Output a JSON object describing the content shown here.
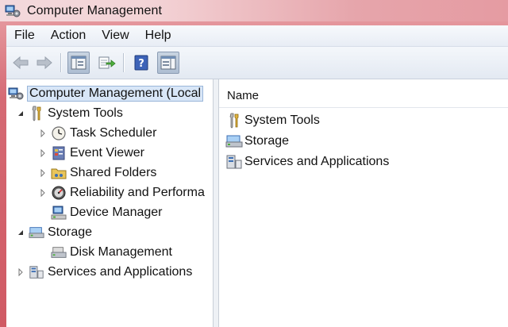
{
  "window": {
    "title": "Computer Management"
  },
  "menubar": {
    "items": [
      "File",
      "Action",
      "View",
      "Help"
    ]
  },
  "toolbar": {
    "buttons": [
      {
        "icon": "back-arrow-icon"
      },
      {
        "icon": "forward-arrow-icon"
      },
      {
        "icon": "show-hide-console-tree-icon",
        "pressed": true
      },
      {
        "icon": "export-list-icon"
      },
      {
        "icon": "help-icon"
      },
      {
        "icon": "show-hide-action-pane-icon",
        "pressed": true
      }
    ]
  },
  "tree": {
    "items": [
      {
        "label": "Computer Management (Local",
        "icon": "computer-management-icon",
        "level": 0,
        "expander": "none",
        "selected": true
      },
      {
        "label": "System Tools",
        "icon": "tools-icon",
        "level": 1,
        "expander": "expanded"
      },
      {
        "label": "Task Scheduler",
        "icon": "clock-icon",
        "level": 2,
        "expander": "collapsed"
      },
      {
        "label": "Event Viewer",
        "icon": "event-viewer-icon",
        "level": 2,
        "expander": "collapsed"
      },
      {
        "label": "Shared Folders",
        "icon": "shared-folders-icon",
        "level": 2,
        "expander": "collapsed"
      },
      {
        "label": "Reliability and Performa",
        "icon": "performance-icon",
        "level": 2,
        "expander": "collapsed"
      },
      {
        "label": "Device Manager",
        "icon": "device-manager-icon",
        "level": 2,
        "expander": "none"
      },
      {
        "label": "Storage",
        "icon": "storage-icon",
        "level": 1,
        "expander": "expanded"
      },
      {
        "label": "Disk Management",
        "icon": "disk-management-icon",
        "level": 2,
        "expander": "none"
      },
      {
        "label": "Services and Applications",
        "icon": "services-icon",
        "level": 1,
        "expander": "collapsed"
      }
    ]
  },
  "list": {
    "column_header": "Name",
    "items": [
      {
        "label": "System Tools",
        "icon": "tools-icon"
      },
      {
        "label": "Storage",
        "icon": "storage-icon"
      },
      {
        "label": "Services and Applications",
        "icon": "services-icon"
      }
    ]
  }
}
